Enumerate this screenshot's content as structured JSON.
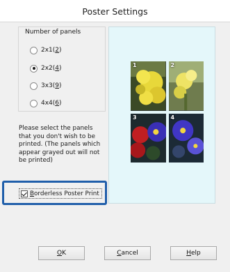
{
  "window": {
    "title": "Poster Settings"
  },
  "panels_group": {
    "legend": "Number of panels",
    "options": [
      {
        "text": "2x1(",
        "key": "2",
        "end": ")",
        "selected": false
      },
      {
        "text": "2x2(",
        "key": "4",
        "end": ")",
        "selected": true
      },
      {
        "text": "3x3(",
        "key": "9",
        "end": ")",
        "selected": false
      },
      {
        "text": "4x4(",
        "key": "6",
        "end": ")",
        "selected": false
      }
    ]
  },
  "instruction": "Please select the panels that you don't wish to be printed. (The panels which appear grayed out will not be printed)",
  "borderless": {
    "label_pre": "",
    "label_key": "B",
    "label_rest": "orderless Poster Print",
    "checked": true
  },
  "preview": {
    "panel_numbers": [
      "1",
      "2",
      "3",
      "4"
    ]
  },
  "buttons": {
    "ok": {
      "key": "O",
      "rest": "K"
    },
    "cancel": {
      "key": "C",
      "rest": "ancel"
    },
    "help": {
      "key": "H",
      "rest": "elp"
    }
  },
  "colors": {
    "highlight": "#1f5eaa",
    "preview_bg": "#e4f7fa"
  }
}
